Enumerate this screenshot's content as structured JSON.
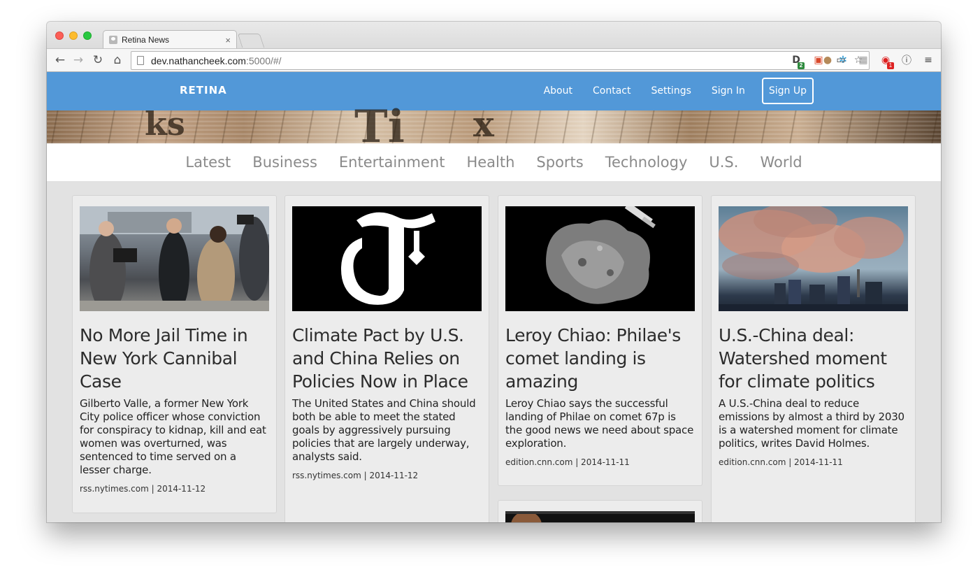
{
  "browser": {
    "tab_title": "Retina News",
    "tab_close": "×",
    "url_host": "dev.nathancheek.com",
    "url_path": ":5000/#/",
    "extension_badges": [
      "2",
      "1"
    ]
  },
  "site": {
    "brand": "RETINA",
    "nav": [
      "About",
      "Contact",
      "Settings",
      "Sign In"
    ],
    "signup": "Sign Up",
    "categories": [
      "Latest",
      "Business",
      "Entertainment",
      "Health",
      "Sports",
      "Technology",
      "U.S.",
      "World"
    ]
  },
  "articles": [
    {
      "title": "No More Jail Time in New York Cannibal Case",
      "summary": "Gilberto Valle, a former New York City police officer whose conviction for conspiracy to kidnap, kill and eat women was overturned, was sentenced to time served on a lesser charge.",
      "meta": "rss.nytimes.com | 2014-11-12"
    },
    {
      "title": "Climate Pact by U.S. and China Relies on Policies Now in Place",
      "summary": "The United States and China should both be able to meet the stated goals by aggressively pursuing policies that are largely underway, analysts said.",
      "meta": "rss.nytimes.com | 2014-11-12"
    },
    {
      "title": "Leroy Chiao: Philae's comet landing is amazing",
      "summary": "Leroy Chiao says the successful landing of Philae on comet 67p is the good news we need about space exploration.",
      "meta": "edition.cnn.com | 2014-11-11"
    },
    {
      "title": "U.S.-China deal: Watershed moment for climate politics",
      "summary": "A U.S.-China deal to reduce emissions by almost a third by 2030 is a watershed moment for climate politics, writes David Holmes.",
      "meta": "edition.cnn.com | 2014-11-11"
    }
  ],
  "colors": {
    "navbar": "#5298d8",
    "page_bg": "#e2e2e2",
    "card_bg": "#ececec",
    "category_text": "#8a8a8a"
  }
}
